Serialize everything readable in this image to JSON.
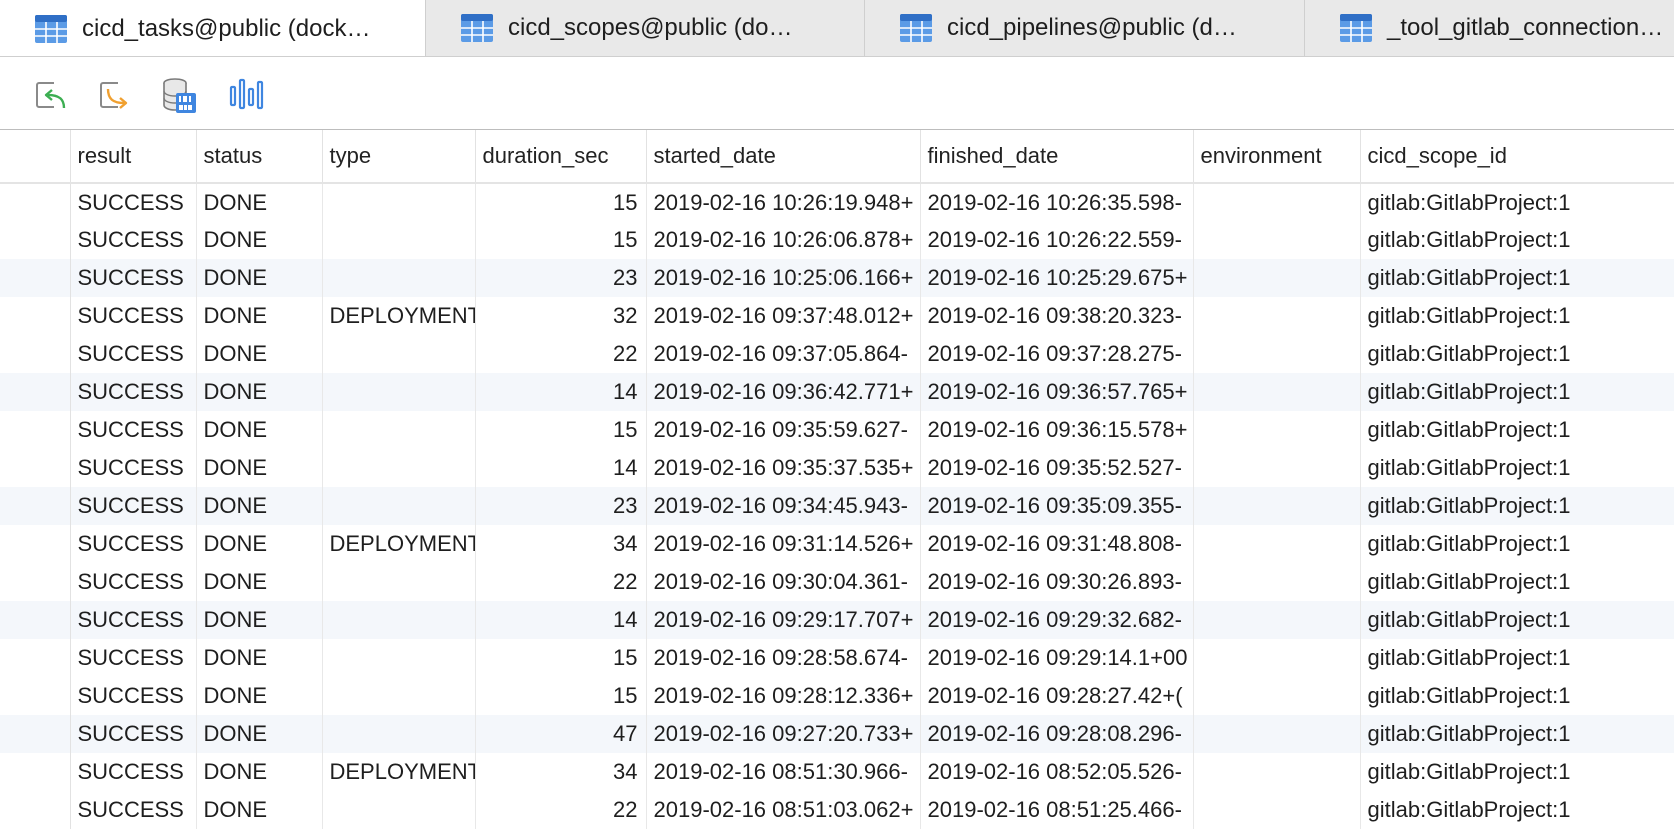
{
  "tabs": [
    {
      "label": "cicd_tasks@public (dock…",
      "active": true
    },
    {
      "label": "cicd_scopes@public (do…",
      "active": false
    },
    {
      "label": "cicd_pipelines@public (d…",
      "active": false
    },
    {
      "label": "_tool_gitlab_connection…",
      "active": false
    }
  ],
  "toolbar": {
    "icons": [
      "undo-icon",
      "redo-icon",
      "data-type-icon",
      "chart-icon"
    ]
  },
  "columns": [
    "",
    "result",
    "status",
    "type",
    "duration_sec",
    "started_date",
    "finished_date",
    "environment",
    "cicd_scope_id"
  ],
  "rows": [
    [
      "",
      "SUCCESS",
      "DONE",
      "",
      "15",
      "2019-02-16 10:26:19.948+",
      "2019-02-16 10:26:35.598-",
      "",
      "gitlab:GitlabProject:1"
    ],
    [
      "",
      "SUCCESS",
      "DONE",
      "",
      "15",
      "2019-02-16 10:26:06.878+",
      "2019-02-16 10:26:22.559-",
      "",
      "gitlab:GitlabProject:1"
    ],
    [
      "",
      "SUCCESS",
      "DONE",
      "",
      "23",
      "2019-02-16 10:25:06.166+",
      "2019-02-16 10:25:29.675+",
      "",
      "gitlab:GitlabProject:1"
    ],
    [
      "",
      "SUCCESS",
      "DONE",
      "DEPLOYMENT",
      "32",
      "2019-02-16 09:37:48.012+",
      "2019-02-16 09:38:20.323-",
      "",
      "gitlab:GitlabProject:1"
    ],
    [
      "",
      "SUCCESS",
      "DONE",
      "",
      "22",
      "2019-02-16 09:37:05.864-",
      "2019-02-16 09:37:28.275-",
      "",
      "gitlab:GitlabProject:1"
    ],
    [
      "",
      "SUCCESS",
      "DONE",
      "",
      "14",
      "2019-02-16 09:36:42.771+",
      "2019-02-16 09:36:57.765+",
      "",
      "gitlab:GitlabProject:1"
    ],
    [
      "",
      "SUCCESS",
      "DONE",
      "",
      "15",
      "2019-02-16 09:35:59.627-",
      "2019-02-16 09:36:15.578+",
      "",
      "gitlab:GitlabProject:1"
    ],
    [
      "",
      "SUCCESS",
      "DONE",
      "",
      "14",
      "2019-02-16 09:35:37.535+",
      "2019-02-16 09:35:52.527-",
      "",
      "gitlab:GitlabProject:1"
    ],
    [
      "",
      "SUCCESS",
      "DONE",
      "",
      "23",
      "2019-02-16 09:34:45.943-",
      "2019-02-16 09:35:09.355-",
      "",
      "gitlab:GitlabProject:1"
    ],
    [
      "",
      "SUCCESS",
      "DONE",
      "DEPLOYMENT",
      "34",
      "2019-02-16 09:31:14.526+",
      "2019-02-16 09:31:48.808-",
      "",
      "gitlab:GitlabProject:1"
    ],
    [
      "",
      "SUCCESS",
      "DONE",
      "",
      "22",
      "2019-02-16 09:30:04.361-",
      "2019-02-16 09:30:26.893-",
      "",
      "gitlab:GitlabProject:1"
    ],
    [
      "",
      "SUCCESS",
      "DONE",
      "",
      "14",
      "2019-02-16 09:29:17.707+",
      "2019-02-16 09:29:32.682-",
      "",
      "gitlab:GitlabProject:1"
    ],
    [
      "",
      "SUCCESS",
      "DONE",
      "",
      "15",
      "2019-02-16 09:28:58.674-",
      "2019-02-16 09:29:14.1+00",
      "",
      "gitlab:GitlabProject:1"
    ],
    [
      "",
      "SUCCESS",
      "DONE",
      "",
      "15",
      "2019-02-16 09:28:12.336+",
      "2019-02-16 09:28:27.42+(",
      "",
      "gitlab:GitlabProject:1"
    ],
    [
      "",
      "SUCCESS",
      "DONE",
      "",
      "47",
      "2019-02-16 09:27:20.733+",
      "2019-02-16 09:28:08.296-",
      "",
      "gitlab:GitlabProject:1"
    ],
    [
      "",
      "SUCCESS",
      "DONE",
      "DEPLOYMENT",
      "34",
      "2019-02-16 08:51:30.966-",
      "2019-02-16 08:52:05.526-",
      "",
      "gitlab:GitlabProject:1"
    ],
    [
      "",
      "SUCCESS",
      "DONE",
      "",
      "22",
      "2019-02-16 08:51:03.062+",
      "2019-02-16 08:51:25.466-",
      "",
      "gitlab:GitlabProject:1"
    ]
  ],
  "colors": {
    "accent_blue": "#3f86e0",
    "undo_green": "#3cae52",
    "redo_orange": "#f0a030",
    "alt_row": "#f4f7fb"
  }
}
